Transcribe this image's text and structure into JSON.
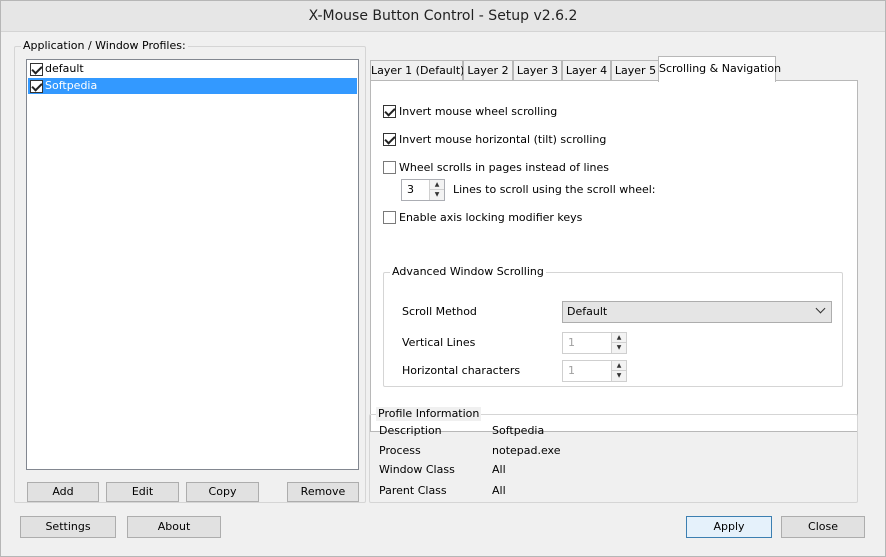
{
  "window": {
    "title": "X-Mouse Button Control - Setup v2.6.2"
  },
  "profiles": {
    "label": "Application / Window Profiles:",
    "items": [
      {
        "label": "default",
        "checked": true,
        "selected": false
      },
      {
        "label": "Softpedia",
        "checked": true,
        "selected": true
      }
    ],
    "buttons": {
      "add": "Add",
      "edit": "Edit",
      "copy": "Copy",
      "remove": "Remove"
    }
  },
  "tabs": [
    {
      "label": "Layer 1 (Default)"
    },
    {
      "label": "Layer 2"
    },
    {
      "label": "Layer 3"
    },
    {
      "label": "Layer 4"
    },
    {
      "label": "Layer 5"
    },
    {
      "label": "Scrolling & Navigation",
      "active": true
    }
  ],
  "scrolling": {
    "invert_wheel": {
      "label": "Invert mouse wheel scrolling",
      "checked": true
    },
    "invert_tilt": {
      "label": "Invert mouse horizontal (tilt) scrolling",
      "checked": true
    },
    "wheel_pages": {
      "label": "Wheel scrolls in pages instead of lines",
      "checked": false
    },
    "lines_value": "3",
    "lines_label": "Lines to scroll using the scroll wheel:",
    "axis_lock": {
      "label": "Enable axis locking modifier keys",
      "checked": false
    }
  },
  "advanced": {
    "title": "Advanced Window Scrolling",
    "scroll_method_label": "Scroll Method",
    "scroll_method_value": "Default",
    "vertical_lines_label": "Vertical Lines",
    "vertical_lines_value": "1",
    "horizontal_chars_label": "Horizontal characters",
    "horizontal_chars_value": "1"
  },
  "profile_info": {
    "title": "Profile Information",
    "rows": [
      {
        "label": "Description",
        "value": "Softpedia"
      },
      {
        "label": "Process",
        "value": "notepad.exe"
      },
      {
        "label": "Window Class",
        "value": "All"
      },
      {
        "label": "Parent Class",
        "value": "All"
      }
    ]
  },
  "footer": {
    "settings": "Settings",
    "about": "About",
    "apply": "Apply",
    "close": "Close"
  }
}
